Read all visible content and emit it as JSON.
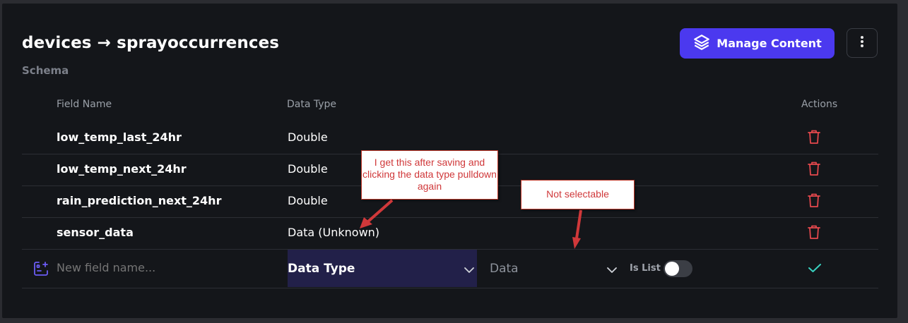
{
  "header": {
    "title": "devices → sprayoccurrences",
    "subtitle": "Schema",
    "manage_label": "Manage Content"
  },
  "columns": {
    "field_name": "Field Name",
    "data_type": "Data Type",
    "actions": "Actions"
  },
  "fields": [
    {
      "name": "low_temp_last_24hr",
      "type": "Double"
    },
    {
      "name": "low_temp_next_24hr",
      "type": "Double"
    },
    {
      "name": "rain_prediction_next_24hr",
      "type": "Double"
    },
    {
      "name": "sensor_data",
      "type": "Data (Unknown)"
    }
  ],
  "new_field": {
    "placeholder": "New field name...",
    "type_value": "Data Type",
    "subtype_value": "Data",
    "is_list_label": "Is List",
    "is_list": false
  },
  "annotations": {
    "callout1": "I get this after saving and clicking the data type pulldown again",
    "callout2": "Not selectable"
  },
  "colors": {
    "accent": "#4b39ef",
    "delete": "#e5484d",
    "confirm": "#39d2c0",
    "background": "#14161a"
  }
}
